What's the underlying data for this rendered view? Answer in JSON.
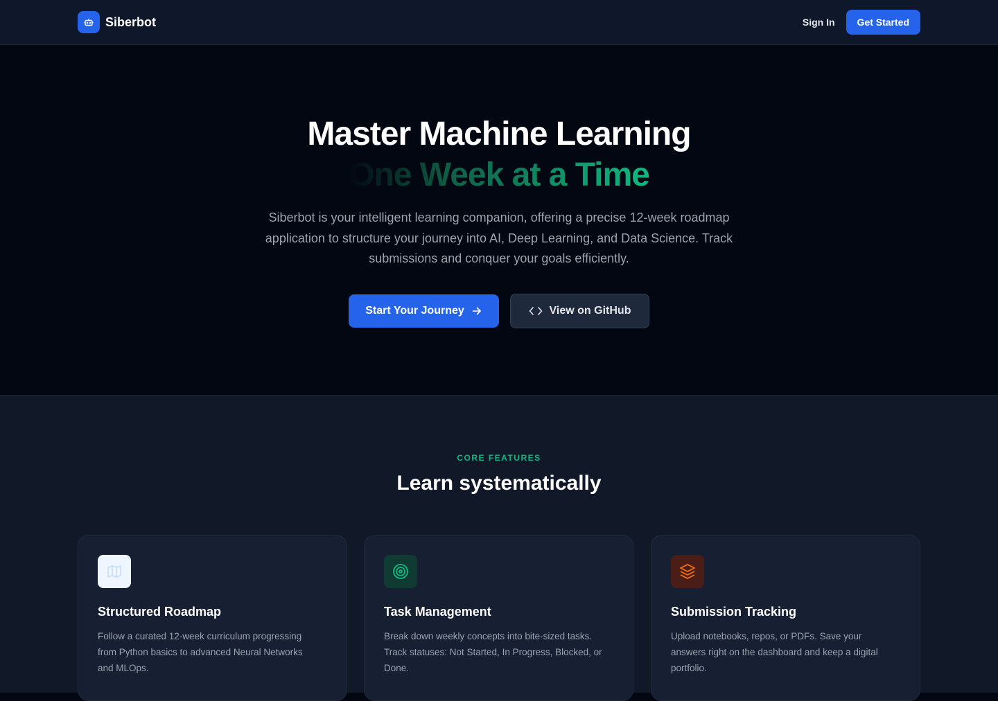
{
  "brand": {
    "name": "Siberbot",
    "icon": "bot-icon"
  },
  "nav": {
    "sign_in": "Sign In",
    "get_started": "Get Started"
  },
  "hero": {
    "title_line1": "Master Machine Learning",
    "title_line2": "One Week at a Time",
    "subtitle": "Siberbot is your intelligent learning companion, offering a precise 12-week roadmap application to structure your journey into AI, Deep Learning, and Data Science. Track submissions and conquer your goals efficiently.",
    "primary_cta": "Start Your Journey",
    "secondary_cta": "View on GitHub"
  },
  "features": {
    "eyebrow": "CORE FEATURES",
    "title": "Learn systematically",
    "cards": [
      {
        "icon": "map-icon",
        "title": "Structured Roadmap",
        "text": "Follow a curated 12-week curriculum progressing from Python basics to advanced Neural Networks and MLOps."
      },
      {
        "icon": "target-icon",
        "title": "Task Management",
        "text": "Break down weekly concepts into bite-sized tasks. Track statuses: Not Started, In Progress, Blocked, or Done."
      },
      {
        "icon": "layers-icon",
        "title": "Submission Tracking",
        "text": "Upload notebooks, repos, or PDFs. Save your answers right on the dashboard and keep a digital portfolio."
      }
    ]
  },
  "colors": {
    "accent": "#2563eb",
    "green": "#10b981",
    "orange": "#f97316",
    "bg": "#030712",
    "surface": "#111827"
  }
}
